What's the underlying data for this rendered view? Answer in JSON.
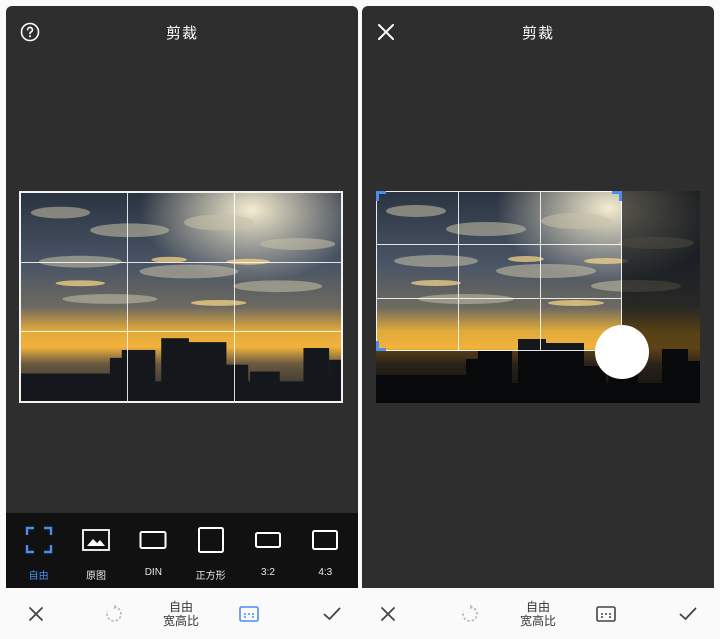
{
  "left": {
    "title": "剪裁",
    "ratios": [
      {
        "label": "自由",
        "icon": "free-crop-icon",
        "active": true
      },
      {
        "label": "原图",
        "icon": "original-image-icon"
      },
      {
        "label": "DIN",
        "icon": "din-ratio-icon"
      },
      {
        "label": "正方形",
        "icon": "square-ratio-icon"
      },
      {
        "label": "3:2",
        "icon": "ratio-3-2-icon"
      },
      {
        "label": "4:3",
        "icon": "ratio-4-3-icon"
      }
    ],
    "bottom": {
      "mode_line1": "自由",
      "mode_line2": "宽高比"
    }
  },
  "right": {
    "title": "剪裁",
    "bottom": {
      "mode_line1": "自由",
      "mode_line2": "宽高比"
    }
  },
  "colors": {
    "accent": "#4a8ef0",
    "panel": "#2e2e2e",
    "strip": "#111111"
  }
}
